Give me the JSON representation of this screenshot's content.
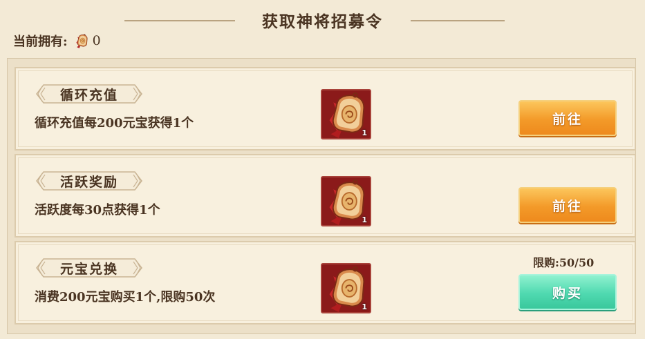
{
  "header": {
    "title": "获取神将招募令",
    "owned_label": "当前拥有:",
    "owned_count": "0"
  },
  "colors": {
    "background": "#f3ead6",
    "text": "#4a3422",
    "go_button": "#f39a29",
    "buy_button": "#4fd9b0",
    "token_frame": "#8b1a1a"
  },
  "rows": [
    {
      "title": "循环充值",
      "description": "循环充值每200元宝获得1个",
      "reward_icon": "recruit-token-icon",
      "reward_qty": "1",
      "button_label": "前往"
    },
    {
      "title": "活跃奖励",
      "description": "活跃度每30点获得1个",
      "reward_icon": "recruit-token-icon",
      "reward_qty": "1",
      "button_label": "前往"
    },
    {
      "title": "元宝兑换",
      "description": "消费200元宝购买1个,限购50次",
      "reward_icon": "recruit-token-icon",
      "reward_qty": "1",
      "limit_text": "限购:50/50",
      "button_label": "购买"
    }
  ]
}
